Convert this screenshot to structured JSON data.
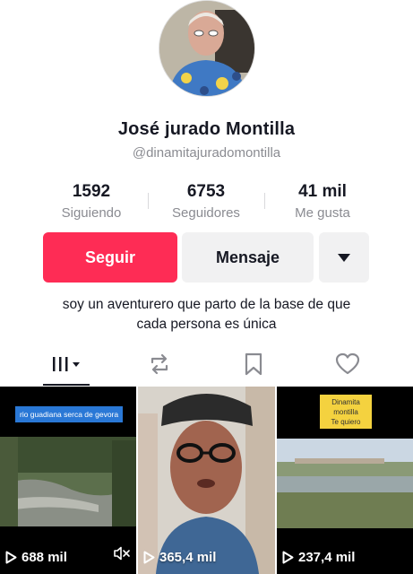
{
  "profile": {
    "name": "José jurado Montilla",
    "handle": "@dinamitajuradomontilla",
    "bio_line1": "soy un aventurero que parto de la base de que",
    "bio_line2": "cada persona es única"
  },
  "stats": [
    {
      "value": "1592",
      "label": "Siguiendo"
    },
    {
      "value": "6753",
      "label": "Seguidores"
    },
    {
      "value": "41 mil",
      "label": "Me gusta"
    }
  ],
  "buttons": {
    "follow": "Seguir",
    "message": "Mensaje"
  },
  "tabs": [
    "videos-grid",
    "reposts",
    "saved",
    "liked"
  ],
  "videos": [
    {
      "overlay_text": "rio guadiana serca de gevora",
      "views": "688 mil"
    },
    {
      "overlay_text": "",
      "views": "365,4 mil"
    },
    {
      "overlay_text_1": "Dinamita",
      "overlay_text_2": "montilla",
      "overlay_text_3": "Te quiero",
      "views": "237,4 mil"
    }
  ],
  "colors": {
    "accent": "#fe2c55",
    "secondary_bg": "#f1f1f2",
    "muted_text": "#8a8b91"
  }
}
